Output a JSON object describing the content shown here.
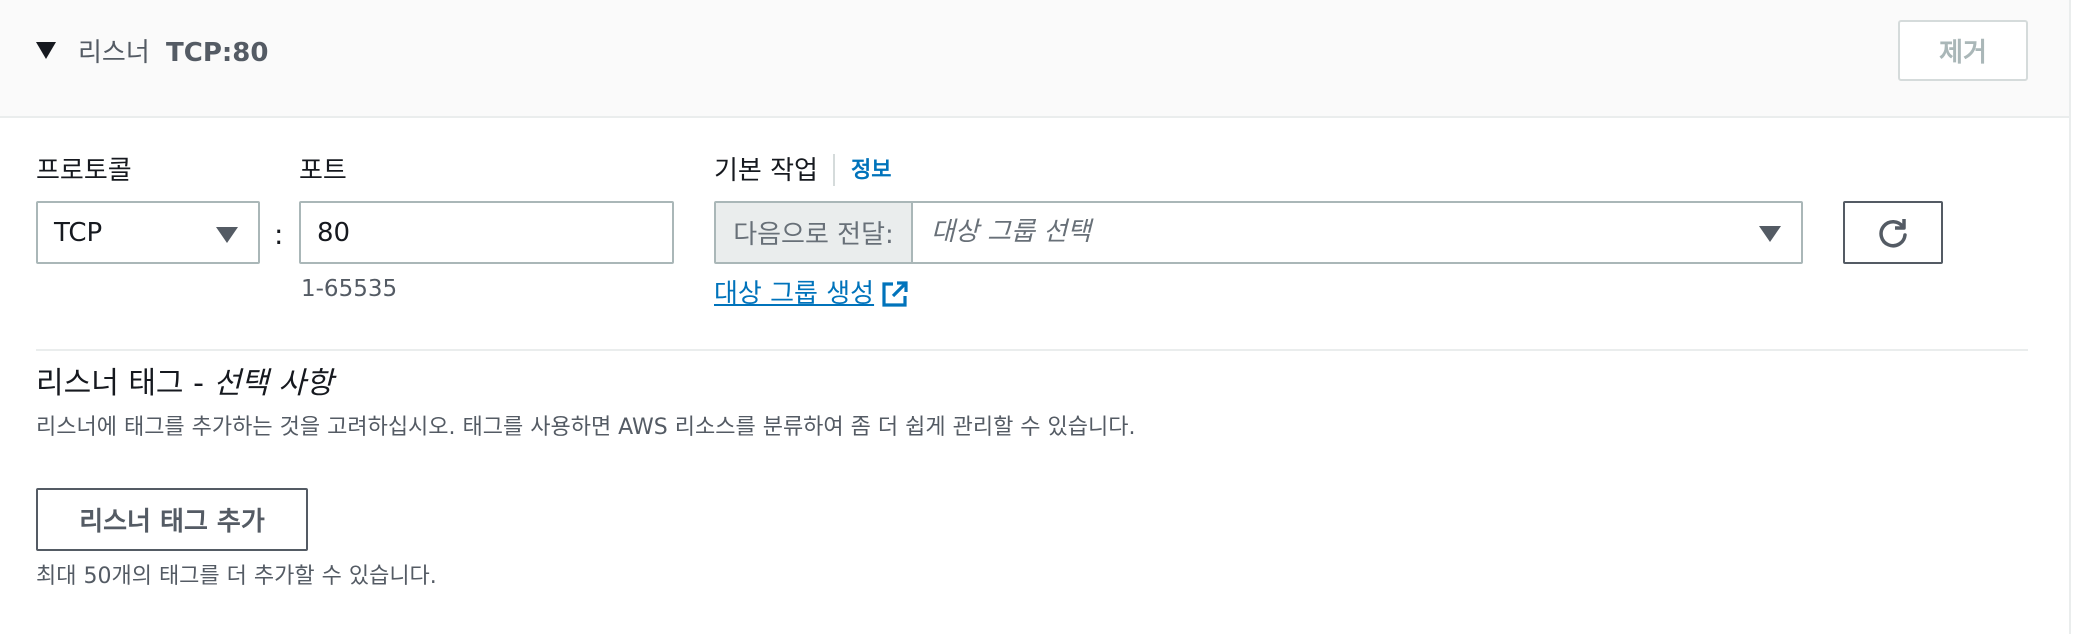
{
  "header": {
    "label": "리스너",
    "value": "TCP:80",
    "remove_label": "제거"
  },
  "protocol": {
    "label": "프로토콜",
    "value": "TCP"
  },
  "port": {
    "label": "포트",
    "value": "80",
    "hint": "1-65535"
  },
  "default_action": {
    "label": "기본 작업",
    "info_label": "정보",
    "prefix": "다음으로 전달:",
    "placeholder": "대상 그룹 선택",
    "create_link": "대상 그룹 생성"
  },
  "tags": {
    "heading": "리스너 태그 -",
    "heading_optional": "선택 사항",
    "description": "리스너에 태그를 추가하는 것을 고려하십시오. 태그를 사용하면 AWS 리소스를 분류하여 좀 더 쉽게 관리할 수 있습니다.",
    "add_button": "리스너 태그 추가",
    "limit_text": "최대 50개의 태그를 더 추가할 수 있습니다."
  },
  "icons": {
    "collapse": "caret-down-icon",
    "select": "caret-down-icon",
    "external": "external-link-icon",
    "refresh": "refresh-icon"
  },
  "colors": {
    "link": "#0073bb",
    "text": "#16191f",
    "muted": "#545b64",
    "border": "#aab7b8",
    "header_bg": "#fafafa"
  }
}
